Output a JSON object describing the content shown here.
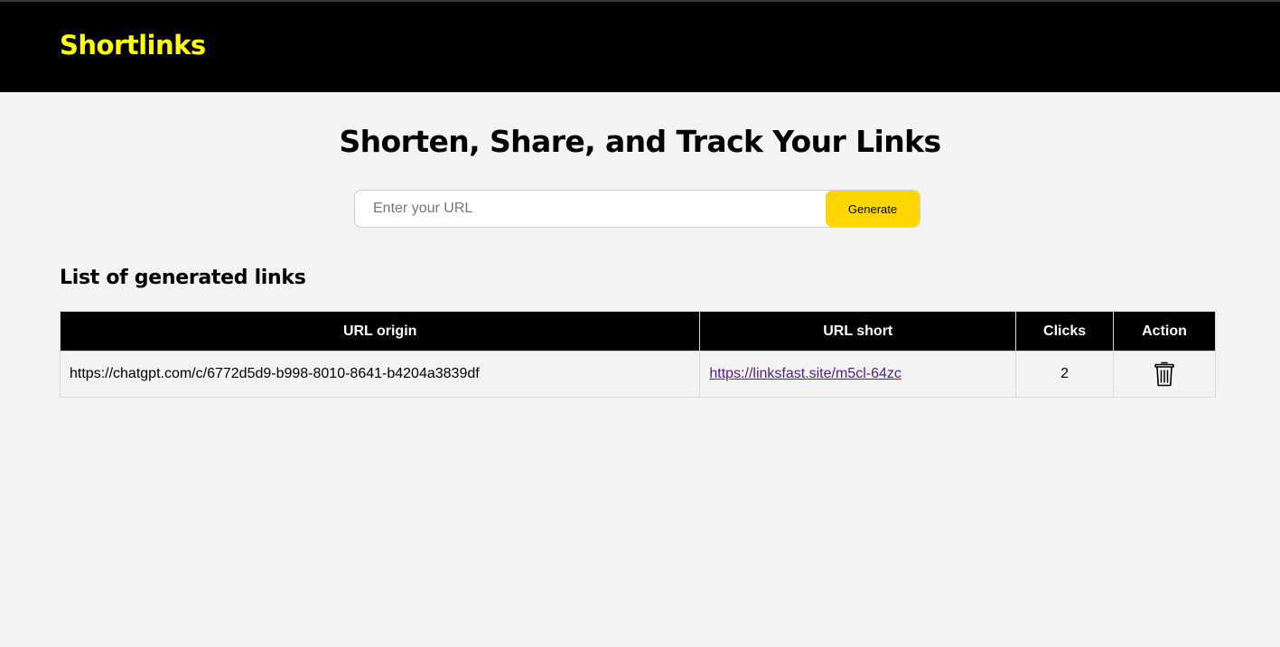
{
  "header": {
    "brand": "Shortlinks",
    "brand_color": "#ffff00"
  },
  "hero": {
    "title": "Shorten, Share, and Track Your Links"
  },
  "form": {
    "placeholder": "Enter your URL",
    "value": "",
    "button_label": "Generate",
    "button_color": "#ffd600"
  },
  "list": {
    "title": "List of generated links",
    "columns": [
      "URL origin",
      "URL short",
      "Clicks",
      "Action"
    ],
    "rows": [
      {
        "origin": "https://chatgpt.com/c/6772d5d9-b998-8010-8641-b4204a3839df",
        "short": "https://linksfast.site/m5cl-64zc",
        "clicks": "2",
        "action_icon": "trash-icon"
      }
    ]
  }
}
